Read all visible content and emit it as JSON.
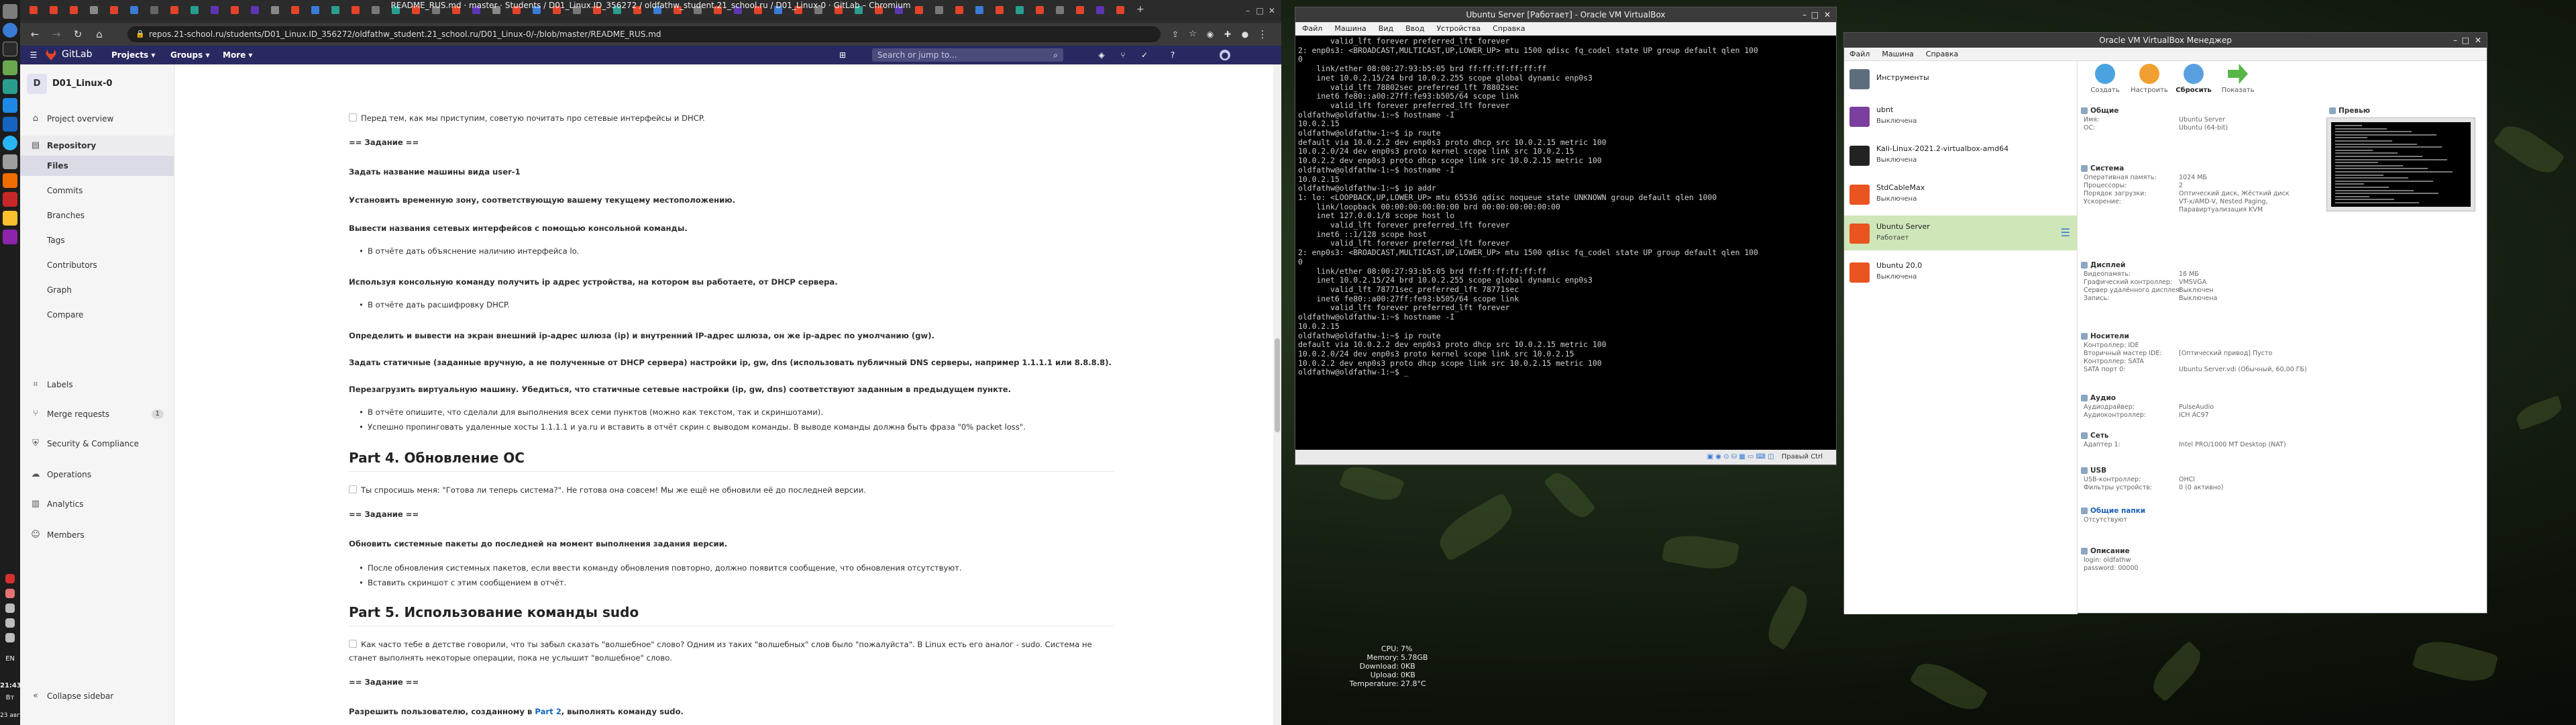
{
  "chrome": {
    "title": "README_RUS.md · master · Students / D01_Linux.ID_356272 / oldfathw_student.21_school.ru / D01_Linux-0 · GitLab – Chromium",
    "url": "repos.21-school.ru/students/D01_Linux.ID_356272/oldfathw_student.21_school.ru/D01_Linux-0/-/blob/master/README_RUS.md",
    "tabs": [
      {
        "label": "",
        "color": "#e24329"
      },
      {
        "label": "",
        "color": "#e24329"
      },
      {
        "label": "",
        "color": "#e24329"
      },
      {
        "label": "",
        "color": "#888888"
      },
      {
        "label": "",
        "color": "#e24329"
      },
      {
        "label": "",
        "color": "#3a7bd5"
      },
      {
        "label": "",
        "color": "#666666"
      },
      {
        "label": "",
        "color": "#e24329"
      },
      {
        "label": "",
        "color": "#2a9d8f"
      },
      {
        "label": "",
        "color": "#5e35b1"
      },
      {
        "label": "",
        "color": "#e24329"
      },
      {
        "label": "",
        "color": "#5e35b1"
      },
      {
        "label": "",
        "color": "#888888"
      },
      {
        "label": "",
        "color": "#e24329"
      },
      {
        "label": "",
        "color": "#3a7bd5"
      },
      {
        "label": "",
        "color": "#2a9d8f"
      },
      {
        "label": "",
        "color": "#e24329"
      },
      {
        "label": "",
        "color": "#777777"
      },
      {
        "label": "",
        "color": "#2a9d8f"
      },
      {
        "label": "",
        "color": "#e24329"
      },
      {
        "label": "",
        "color": "#777777"
      },
      {
        "label": "",
        "color": "#e24329"
      },
      {
        "label": "",
        "color": "#5e35b1"
      },
      {
        "label": "",
        "color": "#888888"
      },
      {
        "label": "",
        "color": "#e24329"
      },
      {
        "label": "",
        "color": "#3a7bd5"
      },
      {
        "label": "",
        "color": "#e24329"
      },
      {
        "label": "",
        "color": "#777777"
      },
      {
        "label": "",
        "color": "#e24329"
      },
      {
        "label": "",
        "color": "#2a9d8f"
      },
      {
        "label": "",
        "color": "#e24329"
      },
      {
        "label": "",
        "color": "#3a7bd5"
      },
      {
        "label": "",
        "color": "#e24329"
      },
      {
        "label": "",
        "color": "#777777"
      },
      {
        "label": "",
        "color": "#e24329"
      },
      {
        "label": "",
        "color": "#5e35b1"
      },
      {
        "label": "",
        "color": "#e24329"
      },
      {
        "label": "",
        "color": "#3a7bd5"
      },
      {
        "label": "",
        "color": "#e24329"
      },
      {
        "label": "",
        "color": "#777777"
      },
      {
        "label": "",
        "color": "#e24329"
      },
      {
        "label": "",
        "color": "#2a9d8f"
      },
      {
        "label": "",
        "color": "#e24329"
      },
      {
        "label": "",
        "color": "#5e35b1"
      },
      {
        "label": "",
        "color": "#e24329"
      },
      {
        "label": "",
        "color": "#777777"
      },
      {
        "label": "",
        "color": "#e24329"
      },
      {
        "label": "",
        "color": "#3a7bd5"
      },
      {
        "label": "",
        "color": "#e24329"
      },
      {
        "label": "",
        "color": "#2a9d8f"
      },
      {
        "label": "",
        "color": "#e24329"
      },
      {
        "label": "",
        "color": "#777777"
      },
      {
        "label": "",
        "color": "#e24329"
      },
      {
        "label": "",
        "color": "#5e35b1"
      },
      {
        "label": "",
        "color": "#e24329"
      }
    ]
  },
  "gitlab": {
    "brand": "GitLab",
    "nav": {
      "projects": "Projects ▾",
      "groups": "Groups ▾",
      "more": "More ▾"
    },
    "search_placeholder": "Search or jump to...",
    "accent": "#292961"
  },
  "sidebar": {
    "project_initial": "D",
    "project_name": "D01_Linux-0",
    "overview": "Project overview",
    "repository": "Repository",
    "repo_items": [
      "Files",
      "Commits",
      "Branches",
      "Tags",
      "Contributors",
      "Graph",
      "Compare"
    ],
    "labels": "Labels",
    "merge_requests": "Merge requests",
    "merge_count": "1",
    "security": "Security & Compliance",
    "operations": "Operations",
    "analytics": "Analytics",
    "members": "Members",
    "collapse": "Collapse sidebar"
  },
  "readme": {
    "intro": "Перед тем, как мы приступим, советую почитать про сетевые интерфейсы и DHCP.",
    "task1": "== Задание ==",
    "s1": "Задать название машины вида user-1",
    "s2": "Установить временную зону, соответствующую вашему текущему местоположению.",
    "s3": "Вывести названия сетевых интерфейсов с помощью консольной команды.",
    "s3b": "В отчёте дать объяснение наличию интерфейса lo.",
    "s4": "Используя консольную команду получить ip адрес устройства, на котором вы работаете, от DHCP сервера.",
    "s4b": "В отчёте дать расшифровку DHCP.",
    "s5": "Определить и вывести на экран внешний ip-адрес шлюза (ip) и внутренний IP-адрес шлюза, он же ip-адрес по умолчанию (gw).",
    "s6": "Задать статичные (заданные вручную, а не полученные от DHCP сервера) настройки ip, gw, dns (использовать публичный DNS серверы, например 1.1.1.1 или 8.8.8.8).",
    "s7": "Перезагрузить виртуальную машину. Убедиться, что статичные сетевые настройки (ip, gw, dns) соответствуют заданным в предыдущем пункте.",
    "s7b1": "В отчёте опишите, что сделали для выполнения всех семи пунктов (можно как текстом, так и скриншотами).",
    "s7b2": "Успешно пропинговать удаленные хосты 1.1.1.1 и ya.ru и вставить в отчёт скрин с выводом команды. В выводе команды должна быть фраза \"0% packet loss\".",
    "h4": "Part 4. Обновление ОС",
    "p4": "Ты спросишь меня: \"Готова ли теперь система?\". Не готова она совсем! Мы же ещё не обновили её до последней версии.",
    "task4": "== Задание ==",
    "s8": "Обновить системные пакеты до последней на момент выполнения задания версии.",
    "s8b1": "После обновления системных пакетов, если ввести команду обновления повторно, должно появится сообщение, что обновления отсутствуют.",
    "s8b2": "Вставить скриншот с этим сообщением в отчёт.",
    "h5": "Part 5. Использование команды sudo",
    "p5a": "Как часто тебе в детстве говорили, что ты забыл сказать \"волшебное\" слово? Одним из таких \"волшебных\" слов было \"пожалуйста\". В Linux есть его аналог - sudo. Система не",
    "p5b": "станет выполнять некоторые операции, пока не услышит \"волшебное\" слово.",
    "task5": "== Задание ==",
    "s9a": "Разрешить пользователю, созданному в ",
    "s9link": "Part 2",
    "s9b": ", выполнять команду sudo."
  },
  "vm_window": {
    "title": "Ubuntu Server [Работает] - Oracle VM VirtualBox",
    "menu": [
      "Файл",
      "Машина",
      "Вид",
      "Ввод",
      "Устройства",
      "Справка"
    ],
    "status": "Правый Ctrl",
    "terminal": [
      "       valid_lft forever preferred_lft forever",
      "2: enp0s3: <BROADCAST,MULTICAST,UP,LOWER_UP> mtu 1500 qdisc fq_codel state UP group default qlen 100",
      "0",
      "    link/ether 08:00:27:93:b5:05 brd ff:ff:ff:ff:ff:ff",
      "    inet 10.0.2.15/24 brd 10.0.2.255 scope global dynamic enp0s3",
      "       valid_lft 78802sec preferred_lft 78802sec",
      "    inet6 fe80::a00:27ff:fe93:b505/64 scope link",
      "       valid_lft forever preferred_lft forever",
      "oldfathw@oldfathw-1:~$ hostname -I",
      "10.0.2.15",
      "oldfathw@oldfathw-1:~$ ip route",
      "default via 10.0.2.2 dev enp0s3 proto dhcp src 10.0.2.15 metric 100",
      "10.0.2.0/24 dev enp0s3 proto kernel scope link src 10.0.2.15",
      "10.0.2.2 dev enp0s3 proto dhcp scope link src 10.0.2.15 metric 100",
      "oldfathw@oldfathw-1:~$ hostname -I",
      "10.0.2.15",
      "oldfathw@oldfathw-1:~$ ip addr",
      "1: lo: <LOOPBACK,UP,LOWER_UP> mtu 65536 qdisc noqueue state UNKNOWN group default qlen 1000",
      "    link/loopback 00:00:00:00:00:00 brd 00:00:00:00:00:00",
      "    inet 127.0.0.1/8 scope host lo",
      "       valid_lft forever preferred_lft forever",
      "    inet6 ::1/128 scope host",
      "       valid_lft forever preferred_lft forever",
      "2: enp0s3: <BROADCAST,MULTICAST,UP,LOWER_UP> mtu 1500 qdisc fq_codel state UP group default qlen 100",
      "0",
      "    link/ether 08:00:27:93:b5:05 brd ff:ff:ff:ff:ff:ff",
      "    inet 10.0.2.15/24 brd 10.0.2.255 scope global dynamic enp0s3",
      "       valid_lft 78771sec preferred_lft 78771sec",
      "    inet6 fe80::a00:27ff:fe93:b505/64 scope link",
      "       valid_lft forever preferred_lft forever",
      "oldfathw@oldfathw-1:~$ hostname -I",
      "10.0.2.15",
      "oldfathw@oldfathw-1:~$ ip route",
      "default via 10.0.2.2 dev enp0s3 proto dhcp src 10.0.2.15 metric 100",
      "10.0.2.0/24 dev enp0s3 proto kernel scope link src 10.0.2.15",
      "10.0.2.2 dev enp0s3 proto dhcp scope link src 10.0.2.15 metric 100",
      "oldfathw@oldfathw-1:~$ _"
    ]
  },
  "vbox_manager": {
    "title": "Oracle VM VirtualBox Менеджер",
    "menu": [
      "Файл",
      "Машина",
      "Справка"
    ],
    "tools": "Инструменты",
    "vms": [
      {
        "name": "ubnt",
        "state": "Выключена",
        "color": "#7b3fa0"
      },
      {
        "name": "Kali-Linux-2021.2-virtualbox-amd64",
        "state": "Выключена",
        "color": "#222222"
      },
      {
        "name": "StdCableMax",
        "state": "Выключена",
        "color": "#e95420"
      },
      {
        "name": "Ubuntu Server",
        "state": "Работает",
        "color": "#e95420"
      },
      {
        "name": "Ubuntu 20.0",
        "state": "Выключена",
        "color": "#e95420"
      }
    ],
    "toolbar": [
      "Создать",
      "Настроить",
      "Сбросить",
      "Показать"
    ],
    "sections": {
      "general": "Общие",
      "system": "Система",
      "display": "Дисплей",
      "storage": "Носители",
      "audio": "Аудио",
      "network": "Сеть",
      "usb": "USB",
      "shared": "Общие папки",
      "description": "Описание",
      "preview": "Превью"
    },
    "general_rows": [
      [
        "Имя:",
        "Ubuntu Server"
      ],
      [
        "ОС:",
        "Ubuntu (64-bit)"
      ]
    ],
    "system_rows": [
      [
        "Оперативная память:",
        "1024 МБ"
      ],
      [
        "Процессоры:",
        "2"
      ],
      [
        "Порядок загрузки:",
        "Оптический диск, Жёсткий диск"
      ],
      [
        "Ускорение:",
        "VT-x/AMD-V, Nested Paging, Паравиртуализация KVM"
      ]
    ],
    "display_rows": [
      [
        "Видеопамять:",
        "16 МБ"
      ],
      [
        "Графический контроллер:",
        "VMSVGA"
      ],
      [
        "Сервер удалённого дисплея:",
        "Выключен"
      ],
      [
        "Запись:",
        "Выключена"
      ]
    ],
    "storage_rows": [
      [
        "Контроллер: IDE",
        ""
      ],
      [
        "Вторичный мастер IDE:",
        "[Оптический привод] Пусто"
      ],
      [
        "Контроллер: SATA",
        ""
      ],
      [
        "SATA порт 0:",
        "Ubuntu Server.vdi (Обычный, 60,00 ГБ)"
      ]
    ],
    "audio_rows": [
      [
        "Аудиодрайвер:",
        "PulseAudio"
      ],
      [
        "Аудиоконтроллер:",
        "ICH AC97"
      ]
    ],
    "network_rows": [
      [
        "Адаптер 1:",
        "Intel PRO/1000 MT Desktop (NAT)"
      ]
    ],
    "usb_rows": [
      [
        "USB-контроллер:",
        "OHCI"
      ],
      [
        "Фильтры устройств:",
        "0 (0 активно)"
      ]
    ],
    "shared_rows": [
      [
        "Отсутствуют",
        ""
      ]
    ],
    "desc_rows": [
      [
        "login: oldfathw",
        ""
      ],
      [
        "password: 00000",
        ""
      ]
    ]
  },
  "sysmon": {
    "rows": [
      [
        "CPU:",
        "7%"
      ],
      [
        "Memory:",
        "5.78GB"
      ],
      [
        "Download:",
        "0KB"
      ],
      [
        "Upload:",
        "0KB"
      ],
      [
        "Temperature:",
        "27.8°C"
      ]
    ]
  },
  "dock": {
    "time": "21:43",
    "lang": "EN",
    "extra": "Вт",
    "date": "23 авг"
  }
}
